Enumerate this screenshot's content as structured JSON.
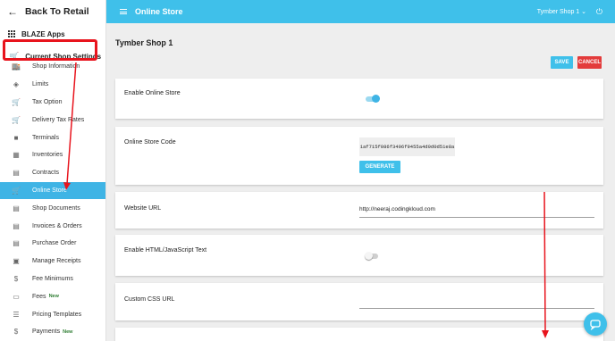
{
  "sidebar": {
    "back_label": "Back To Retail",
    "apps_label": "BLAZE Apps",
    "current_label": "Current Shop Settings",
    "items": [
      {
        "label": "Shop Information",
        "icon": "store-icon",
        "glyph": "🏬",
        "new": ""
      },
      {
        "label": "Limits",
        "icon": "shield-icon",
        "glyph": "◈",
        "new": ""
      },
      {
        "label": "Tax Option",
        "icon": "cart-icon",
        "glyph": "🛒",
        "new": ""
      },
      {
        "label": "Delivery Tax Rates",
        "icon": "cart-plus-icon",
        "glyph": "🛒",
        "new": ""
      },
      {
        "label": "Terminals",
        "icon": "briefcase-icon",
        "glyph": "■",
        "new": ""
      },
      {
        "label": "Inventories",
        "icon": "calendar-icon",
        "glyph": "▦",
        "new": ""
      },
      {
        "label": "Contracts",
        "icon": "library-icon",
        "glyph": "▤",
        "new": ""
      },
      {
        "label": "Online Store",
        "icon": "cart-icon",
        "glyph": "🛒",
        "new": "",
        "active": true
      },
      {
        "label": "Shop Documents",
        "icon": "document-icon",
        "glyph": "▤",
        "new": ""
      },
      {
        "label": "Invoices & Orders",
        "icon": "list-icon",
        "glyph": "▤",
        "new": ""
      },
      {
        "label": "Purchase Order",
        "icon": "list-icon",
        "glyph": "▤",
        "new": ""
      },
      {
        "label": "Manage Receipts",
        "icon": "image-icon",
        "glyph": "▣",
        "new": ""
      },
      {
        "label": "Fee Minimums",
        "icon": "dollar-circle-icon",
        "glyph": "$",
        "new": ""
      },
      {
        "label": "Fees",
        "icon": "money-icon",
        "glyph": "▭",
        "new": "New"
      },
      {
        "label": "Pricing Templates",
        "icon": "list-bullets-icon",
        "glyph": "☰",
        "new": ""
      },
      {
        "label": "Payments",
        "icon": "dollar-icon",
        "glyph": "$",
        "new": "New"
      }
    ]
  },
  "topbar": {
    "title": "Online Store",
    "shop_selector": "Tymber Shop 1 ⌄"
  },
  "main": {
    "shop_name": "Tymber Shop 1",
    "save_label": "SAVE",
    "cancel_label": "CANCEL",
    "enable_online_store_label": "Enable Online Store",
    "enable_online_store": true,
    "online_store_code_label": "Online Store Code",
    "online_store_code": "1af715f086f3496f9455a4d9d0d51e8a",
    "generate_label": "GENERATE",
    "website_url_label": "Website URL",
    "website_url": "http://neeraj.codingkloud.com",
    "enable_html_label": "Enable HTML/JavaScript Text",
    "enable_html": false,
    "custom_css_label": "Custom CSS URL",
    "custom_css_value": ""
  },
  "colors": {
    "accent": "#3fc0ea",
    "annotation": "#e8141d",
    "cancel": "#e33b3b"
  }
}
